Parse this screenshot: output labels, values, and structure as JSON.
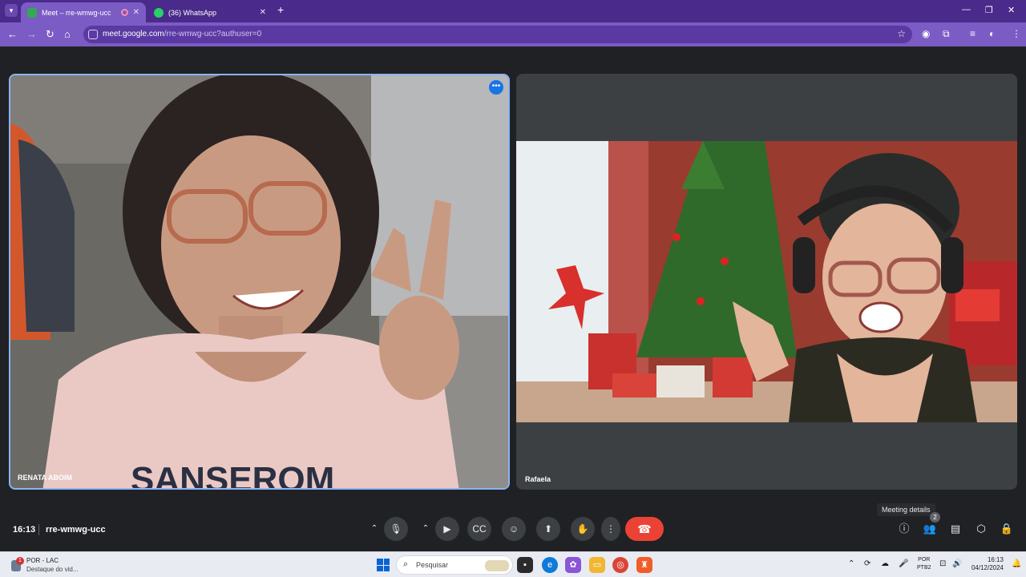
{
  "browser": {
    "tabs": [
      {
        "title": "Meet – rre-wmwg-ucc",
        "favicon_color": "#34a853",
        "active": true
      },
      {
        "title": "(36) WhatsApp",
        "favicon_color": "#25d366",
        "active": false
      }
    ],
    "url_host": "meet.google.com",
    "url_path": "/rre-wmwg-ucc?authuser=0",
    "accent_color": "#7b5bc4"
  },
  "meet": {
    "participants": [
      {
        "name": "RENATA ABOIM",
        "pinned_highlight": true
      },
      {
        "name": "Rafaela"
      }
    ],
    "time": "16:13",
    "meeting_code": "rre-wmwg-ucc",
    "tooltip": "Meeting details",
    "people_count": "2",
    "controls": [
      "chevron-up",
      "mic",
      "chevron-up",
      "camera",
      "captions",
      "emoji",
      "present",
      "raise-hand",
      "more-options",
      "end-call"
    ],
    "end_call_color": "#ea4335"
  },
  "taskbar": {
    "weather_line1": "POR - LAC",
    "weather_line2": "Destaque do vid...",
    "weather_badge": "1",
    "search_placeholder": "Pesquisar",
    "lang_top": "POR",
    "lang_bottom": "PTB2",
    "clock_time": "16:13",
    "clock_date": "04/12/2024"
  }
}
